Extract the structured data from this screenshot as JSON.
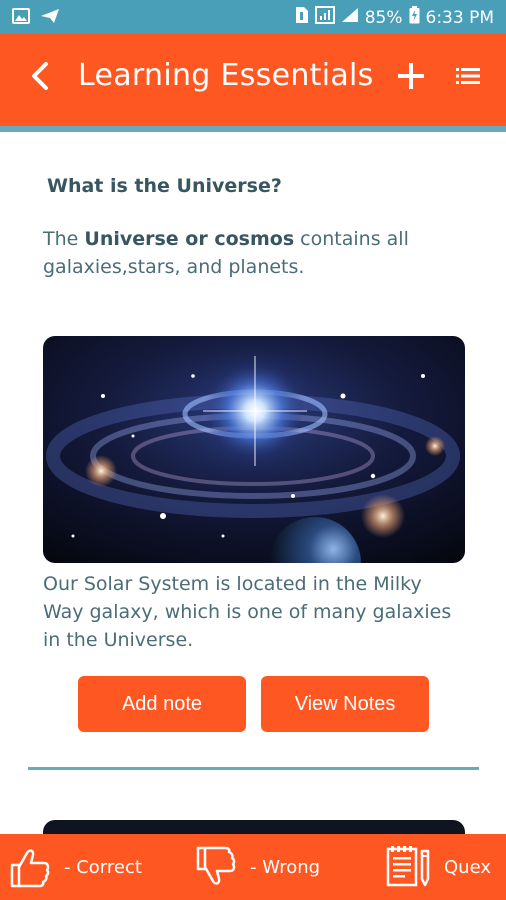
{
  "status_bar": {
    "battery": "85%",
    "time": "6:33 PM"
  },
  "app_bar": {
    "title": "Learning Essentials"
  },
  "content": {
    "question": "What is the Universe?",
    "intro_prefix": "The ",
    "intro_bold": "Universe or cosmos",
    "intro_suffix": " contains all galaxies,stars, and planets.",
    "caption": " Our Solar System is located in the Milky Way galaxy, which is one of many galaxies in the Universe.",
    "add_note_label": "Add note",
    "view_notes_label": "View Notes"
  },
  "bottom_bar": {
    "correct_label": "- Correct",
    "wrong_label": "- Wrong",
    "quex_label": "Quex"
  },
  "colors": {
    "accent": "#ff5722",
    "status_bar": "#4a9fb8",
    "divider": "#6aa9bb",
    "text": "#4a6d77"
  }
}
